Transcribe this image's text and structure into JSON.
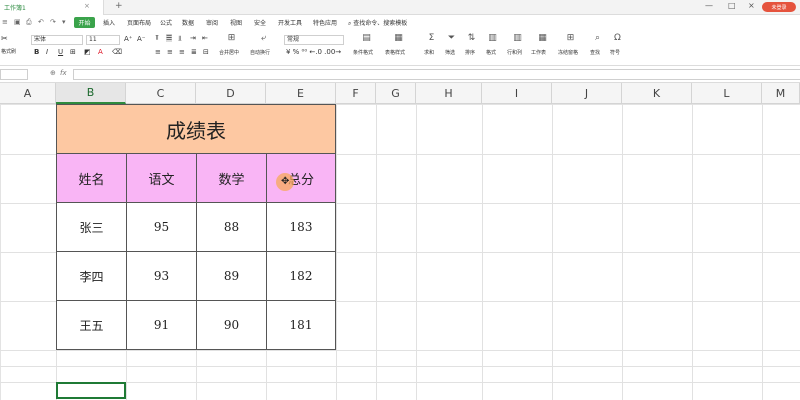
{
  "window": {
    "tab_title": "工作簿1",
    "close_glyph": "×",
    "add_tab_glyph": "+",
    "min_glyph": "—",
    "max_glyph": "□",
    "close_win_glyph": "×",
    "login_label": "未登录"
  },
  "menu": {
    "active_tab": "开始",
    "tabs": [
      "插入",
      "页面布局",
      "公式",
      "数据",
      "审阅",
      "视图",
      "安全",
      "开发工具",
      "特色应用"
    ],
    "search_text": "查找命令、搜索模板"
  },
  "ribbon": {
    "font_name": "宋体",
    "font_size": "11",
    "number_format": "常规",
    "format_painter": "格式刷",
    "merge_center": "合并居中",
    "wrap_text": "自动换行",
    "cond_format": "条件格式",
    "table_style": "表格样式",
    "sum": "求和",
    "filter": "筛选",
    "sort": "排序",
    "format": "格式",
    "row_col": "行和列",
    "worksheet": "工作表",
    "freeze": "冻结窗格",
    "find": "查找",
    "symbol": "符号",
    "bold": "B",
    "italic": "I",
    "underline": "U"
  },
  "formula_bar": {
    "fx": "fx",
    "zoom_glyph": "⊕"
  },
  "columns": [
    "A",
    "B",
    "C",
    "D",
    "E",
    "F",
    "G",
    "H",
    "I",
    "J",
    "K",
    "L",
    "M"
  ],
  "sheet": {
    "title": "成绩表",
    "headers": [
      "姓名",
      "语文",
      "数学",
      "总分"
    ],
    "rows": [
      [
        "张三",
        "95",
        "88",
        "183"
      ],
      [
        "李四",
        "93",
        "89",
        "182"
      ],
      [
        "王五",
        "91",
        "90",
        "181"
      ]
    ]
  },
  "colors": {
    "accent": "#3aa34b",
    "title_fill": "#fdc8a2",
    "header_fill": "#f9b5f5"
  }
}
